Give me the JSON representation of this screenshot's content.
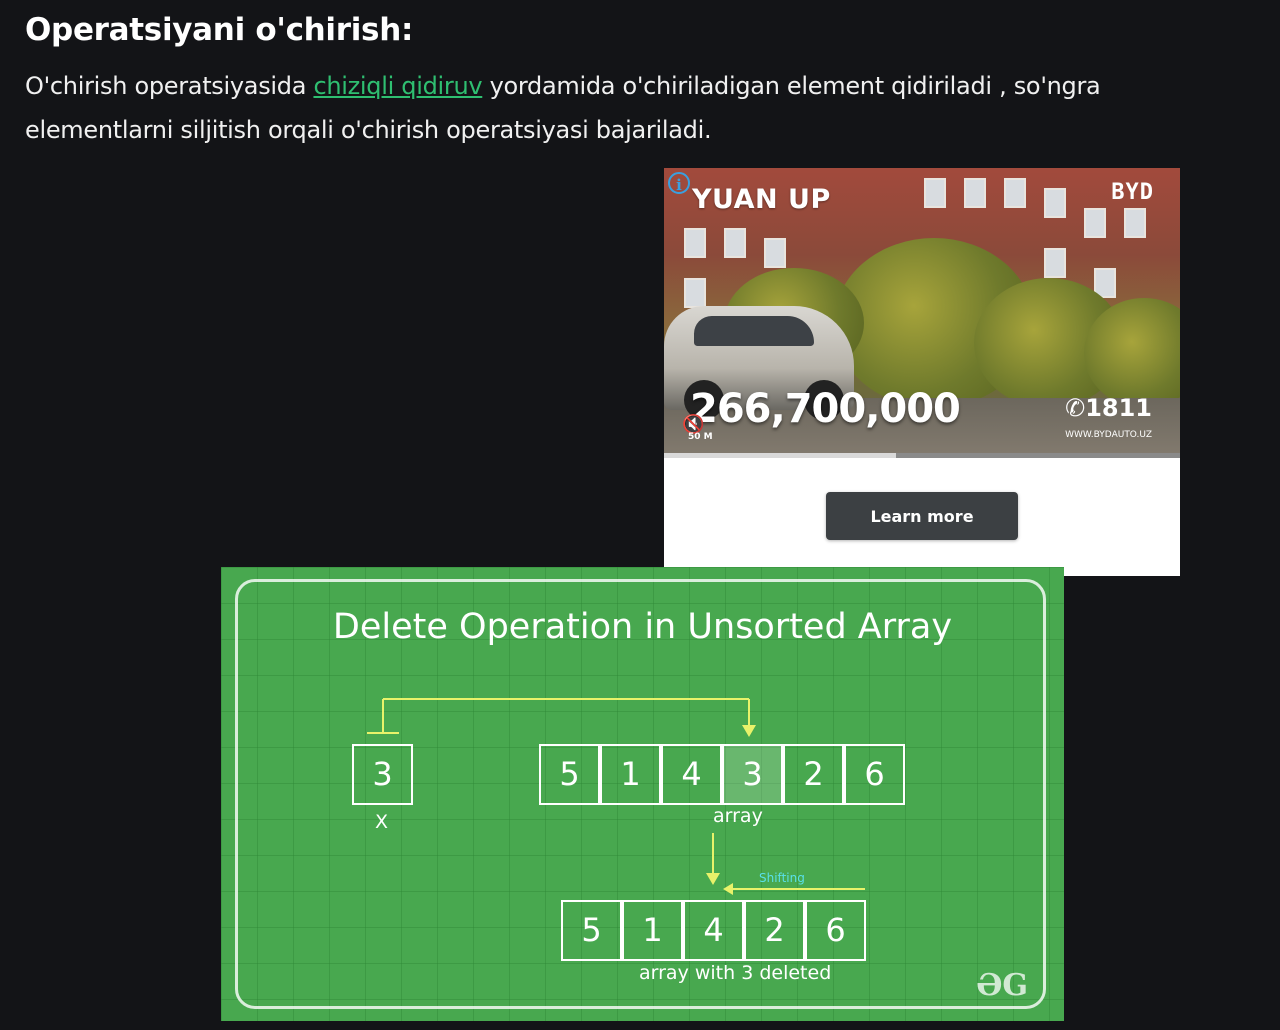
{
  "article": {
    "heading": "Operatsiyani o'chirish:",
    "para_before": "O'chirish operatsiyasida ",
    "link_text": "chiziqli qidiruv",
    "para_after": " yordamida o'chiriladigan element qidiriladi , so'ngra elementlarni siljitish orqali o'chirish operatsiyasi bajariladi."
  },
  "ad": {
    "info_icon": "info-icon",
    "title": "YUAN UP",
    "brand": "BYD",
    "price": "266,700,000",
    "phone": "1811",
    "url": "WWW.BYDAUTO.UZ",
    "mute_icon": "mute-icon",
    "small_label": "50 M",
    "progress": 0.45,
    "cta": "Learn more"
  },
  "diagram": {
    "title": "Delete Operation in Unsorted Array",
    "x_value": "3",
    "x_label": "X",
    "array": [
      "5",
      "1",
      "4",
      "3",
      "2",
      "6"
    ],
    "array_label": "array",
    "shift_label": "Shifting",
    "result": [
      "5",
      "1",
      "4",
      "2",
      "6"
    ],
    "result_label": "array with 3 deleted",
    "logo": "ƏG",
    "arrow_color": "#e8f26a"
  }
}
